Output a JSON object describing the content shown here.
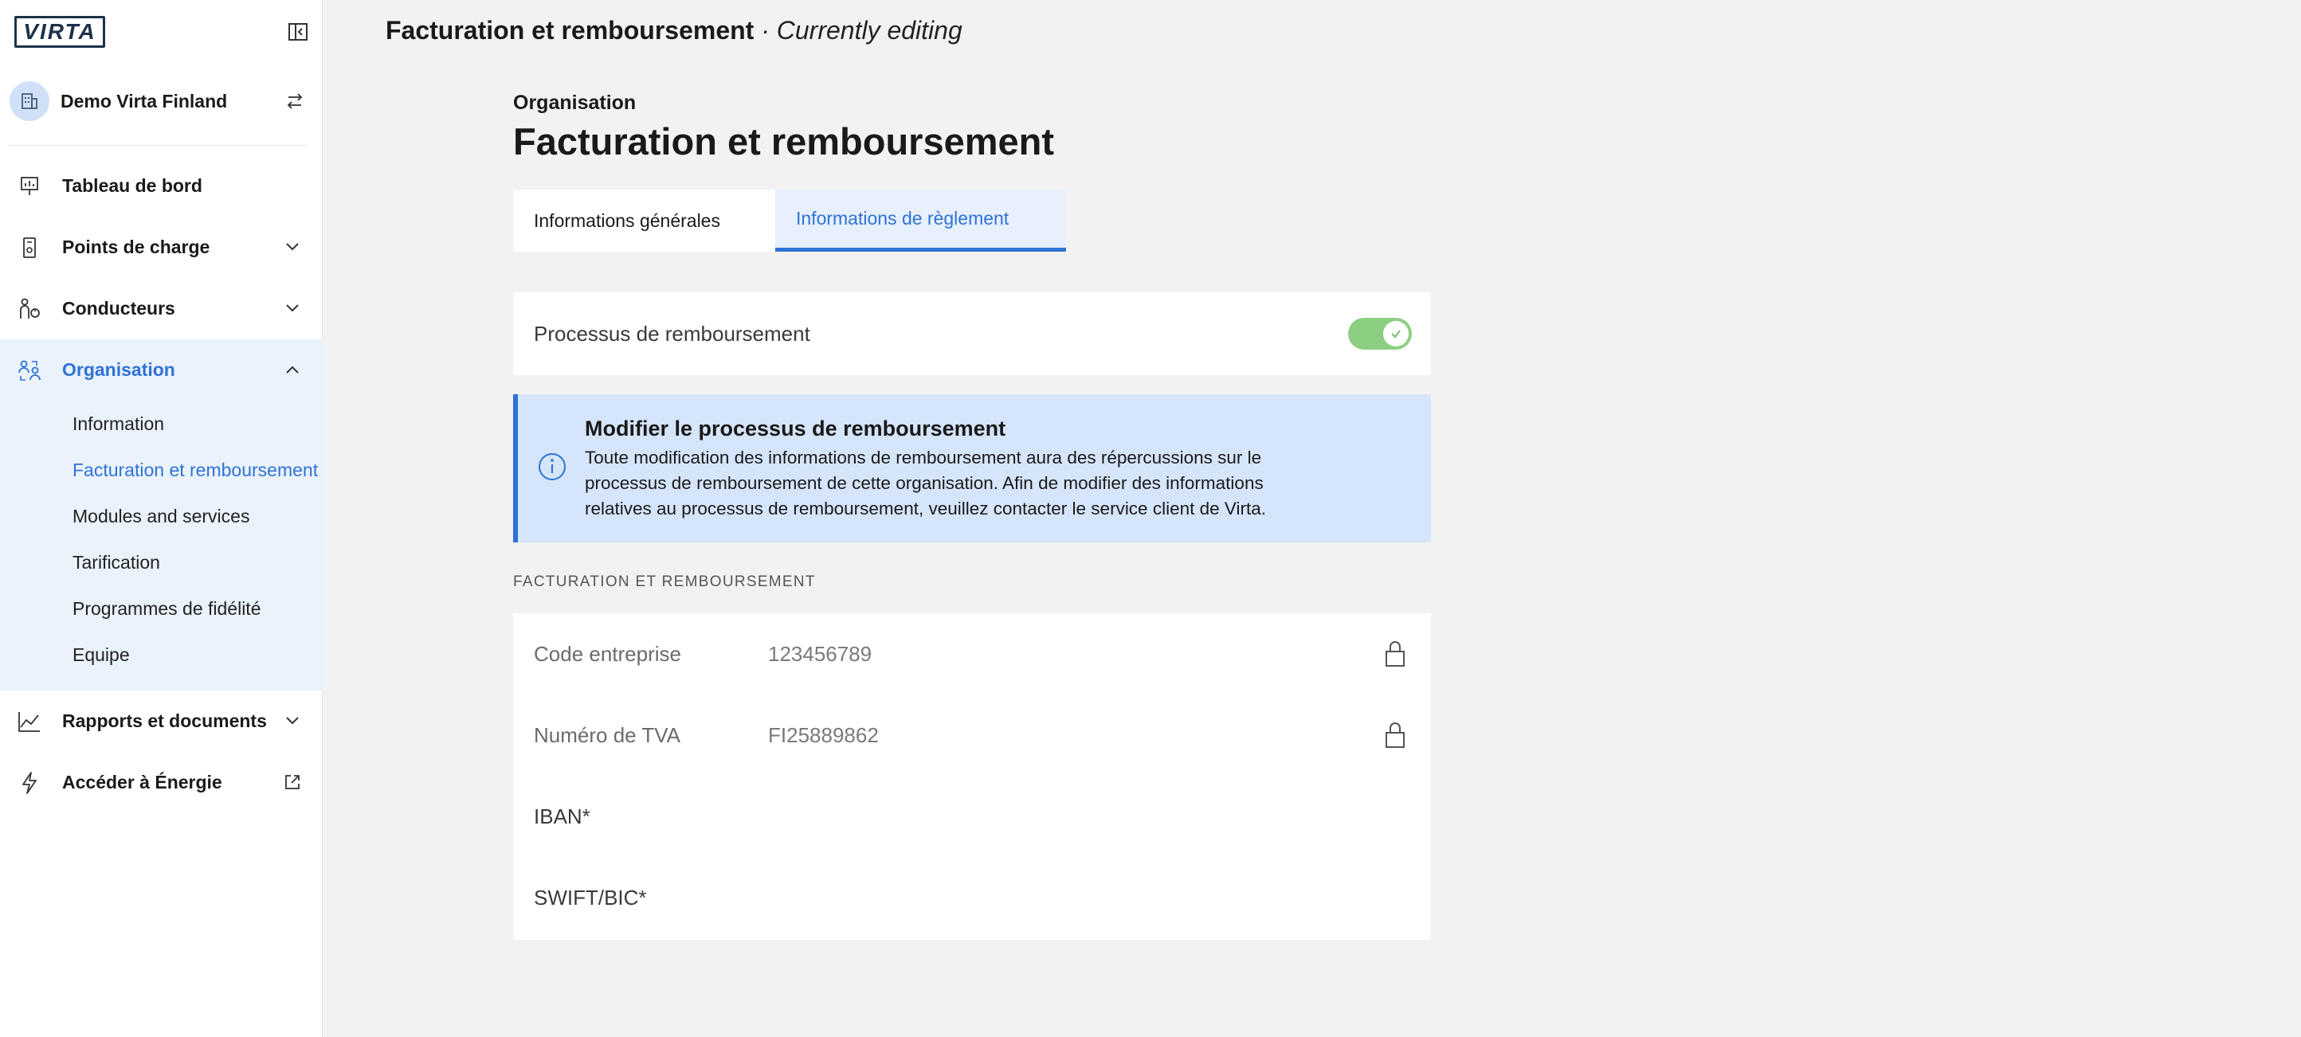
{
  "brand": {
    "logo_text": "VIRTA",
    "accent": "#2f72d6"
  },
  "org_switcher": {
    "name": "Demo Virta Finland"
  },
  "nav": {
    "dashboard": "Tableau de bord",
    "charge_points": "Points de charge",
    "drivers": "Conducteurs",
    "organisation": "Organisation",
    "organisation_sub": [
      "Information",
      "Facturation et remboursement",
      "Modules and services",
      "Tarification",
      "Programmes de fidélité",
      "Equipe"
    ],
    "reports": "Rapports et documents",
    "energy": "Accéder à Énergie"
  },
  "topbar": {
    "title": "Facturation et remboursement",
    "status": " · Currently editing"
  },
  "page": {
    "eyebrow": "Organisation",
    "title": "Facturation et remboursement",
    "tabs": [
      "Informations générales",
      "Informations de règlement"
    ],
    "active_tab": "Informations de règlement"
  },
  "reimbursement": {
    "label": "Processus de remboursement",
    "enabled": true
  },
  "notice": {
    "title": "Modifier le processus de remboursement",
    "body": "Toute modification des informations de remboursement aura des répercussions sur le processus de remboursement de cette organisation. Afin de modifier des informations relatives au processus de remboursement, veuillez contacter le service client de Virta."
  },
  "billing": {
    "section_label": "FACTURATION ET REMBOURSEMENT",
    "company_code_label": "Code entreprise",
    "company_code_value": "123456789",
    "vat_label": "Numéro de TVA",
    "vat_value": "FI25889862",
    "iban_label": "IBAN*",
    "swift_label": "SWIFT/BIC*"
  }
}
